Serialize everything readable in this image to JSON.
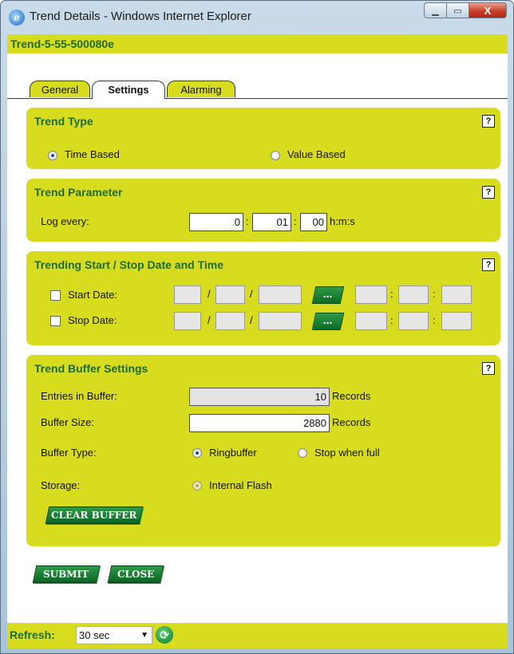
{
  "window": {
    "title": "Trend Details - Windows Internet Explorer",
    "min_label": "▁",
    "max_label": "▭",
    "close_label": "X"
  },
  "object_name": "Trend-5-55-500080e",
  "tabs": [
    {
      "label": "General",
      "active": false
    },
    {
      "label": "Settings",
      "active": true
    },
    {
      "label": "Alarming",
      "active": false
    }
  ],
  "help_label": "?",
  "trend_type": {
    "title": "Trend Type",
    "options": [
      {
        "label": "Time Based",
        "selected": true
      },
      {
        "label": "Value Based",
        "selected": false
      }
    ]
  },
  "trend_parameter": {
    "title": "Trend Parameter",
    "log_label": "Log every:",
    "hours": "0",
    "minutes": "01",
    "seconds": "00",
    "colon": ":",
    "unit": "h:m:s"
  },
  "start_stop": {
    "title": "Trending Start / Stop Date and Time",
    "start_label": "Start Date:",
    "stop_label": "Stop Date:",
    "start_checked": false,
    "stop_checked": false,
    "date_sep": "/",
    "time_sep": ":",
    "picker_label": "..."
  },
  "buffer": {
    "title": "Trend Buffer Settings",
    "entries_label": "Entries in Buffer:",
    "entries_value": "10",
    "size_label": "Buffer Size:",
    "size_value": "2880",
    "records_unit": "Records",
    "type_label": "Buffer Type:",
    "type_options": [
      {
        "label": "Ringbuffer",
        "selected": true
      },
      {
        "label": "Stop when full",
        "selected": false
      }
    ],
    "storage_label": "Storage:",
    "storage_option": "Internal Flash",
    "clear_label": "CLEAR BUFFER"
  },
  "actions": {
    "submit": "SUBMIT",
    "close": "CLOSE"
  },
  "footer": {
    "refresh_label": "Refresh:",
    "refresh_value": "30 sec",
    "arrow": "▼",
    "refresh_icon": "⟳"
  }
}
